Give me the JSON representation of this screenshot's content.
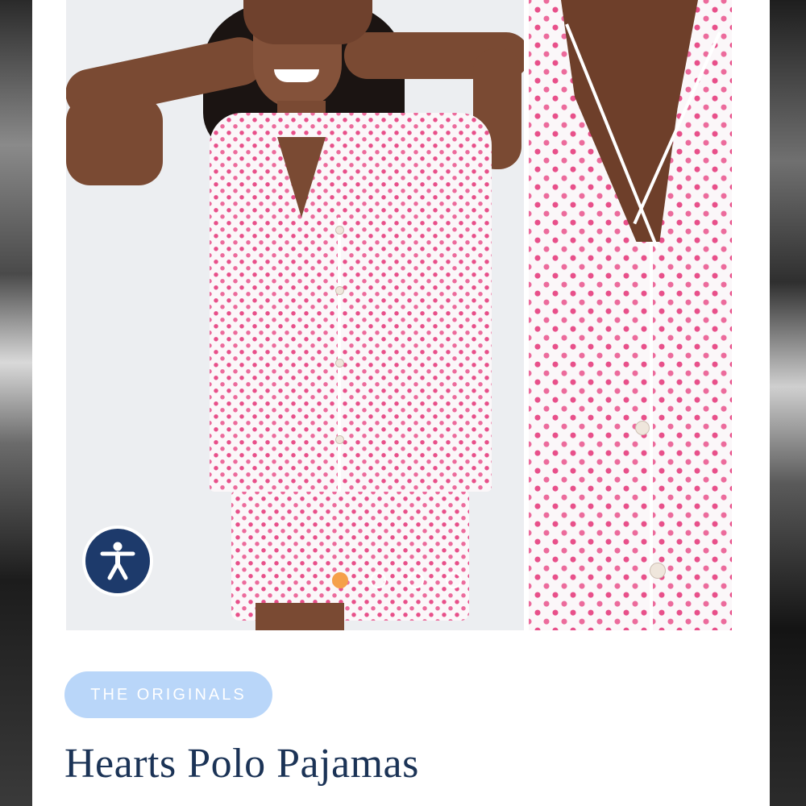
{
  "product": {
    "collection_badge": "THE ORIGINALS",
    "title": "Hearts Polo Pajamas"
  },
  "gallery": {
    "images": [
      {
        "alt": "",
        "role": "main"
      },
      {
        "alt": "",
        "role": "detail"
      }
    ],
    "carousel": {
      "total_dots": 4,
      "active_index": 0
    }
  },
  "accessibility_widget": {
    "icon": "accessibility-person-icon"
  },
  "colors": {
    "badge_bg": "#b9d6f9",
    "badge_text": "#ffffff",
    "title_text": "#1b3356",
    "active_dot": "#f5a04a",
    "a11y_bg": "#1d3a6b",
    "heart_print": "#e8508a"
  }
}
